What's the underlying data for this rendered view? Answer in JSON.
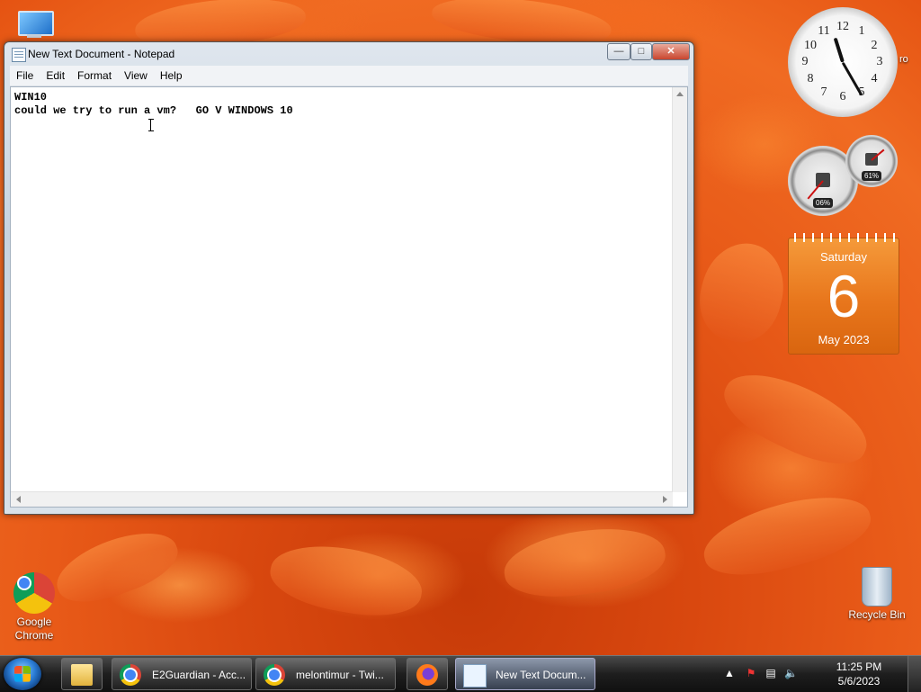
{
  "notepad": {
    "title": "New Text Document - Notepad",
    "menu": [
      "File",
      "Edit",
      "Format",
      "View",
      "Help"
    ],
    "lines": [
      "WIN10",
      "could we try to run a vm?   GO V WINDOWS 10"
    ]
  },
  "desktop": {
    "icons": [
      {
        "label": "Google Chrome",
        "icon": "chrome-icon"
      },
      {
        "label": "Recycle Bin",
        "icon": "recycle-bin-icon"
      }
    ]
  },
  "gadgets": {
    "clock": {
      "numbers": [
        "12",
        "1",
        "2",
        "3",
        "4",
        "5",
        "6",
        "7",
        "8",
        "9",
        "10",
        "11"
      ],
      "hour": 11,
      "minute": 25
    },
    "cpu_meter": {
      "cpu_percent": "06%",
      "memory_percent": "61%"
    },
    "calendar": {
      "weekday": "Saturday",
      "day": "6",
      "month_year": "May 2023"
    },
    "clock_side_text": "ro"
  },
  "taskbar": {
    "buttons": [
      {
        "label": "E2Guardian - Acc...",
        "icon": "chrome-icon"
      },
      {
        "label": "melontimur - Twi...",
        "icon": "chrome-icon"
      },
      {
        "label": "New Text Docum...",
        "icon": "notepad-icon",
        "active": true
      }
    ],
    "tray": {
      "time": "11:25 PM",
      "date": "5/6/2023"
    }
  }
}
